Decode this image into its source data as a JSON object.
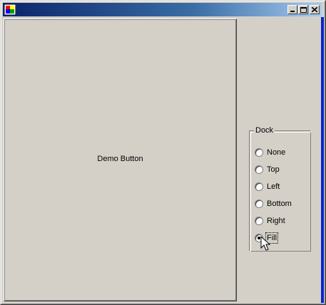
{
  "window": {
    "controls": [
      "minimize",
      "maximize",
      "close"
    ]
  },
  "demo_button": {
    "label": "Demo Button"
  },
  "dock_group": {
    "legend": "Dock",
    "options": [
      {
        "label": "None"
      },
      {
        "label": "Top"
      },
      {
        "label": "Left"
      },
      {
        "label": "Bottom"
      },
      {
        "label": "Right"
      },
      {
        "label": "Fill"
      }
    ],
    "selected": "Fill"
  },
  "colors": {
    "titlebar_start": "#0a246a",
    "titlebar_end": "#a6caf0",
    "face": "#d4d0c8",
    "accent": "#0a24cc"
  }
}
